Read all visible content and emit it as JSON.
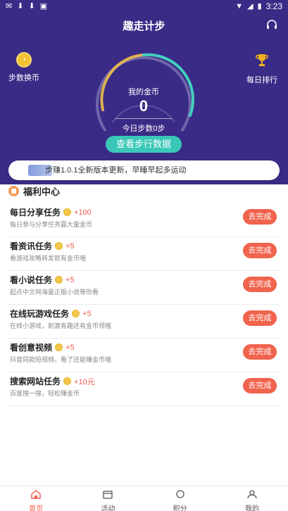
{
  "statusbar": {
    "time": "3:23"
  },
  "app": {
    "title": "趣走计步"
  },
  "side": {
    "left_label": "步数换币",
    "right_label": "每日排行"
  },
  "gauge": {
    "label": "我的金币",
    "coins": "0",
    "steps_text": "今日步数0步",
    "progress": 0.0
  },
  "actions": {
    "view_data": "查看步行数据"
  },
  "notice": {
    "text": "步赚1.0.1全新版本更新，早睡早起多运动"
  },
  "welfare": {
    "title": "福利中心",
    "tasks": [
      {
        "name": "每日分享任务",
        "reward": "+100",
        "desc": "每日参与分享任务赢大量金币",
        "button": "去完成"
      },
      {
        "name": "看资讯任务",
        "reward": "+5",
        "desc": "看游戏攻略转发就有金币哦",
        "button": "去完成"
      },
      {
        "name": "看小说任务",
        "reward": "+5",
        "desc": "起点中文网海量正版小说等你看",
        "button": "去完成"
      },
      {
        "name": "在线玩游戏任务",
        "reward": "+5",
        "desc": "在线小游戏，刺激有趣还有金币领哦",
        "button": "去完成"
      },
      {
        "name": "看创意视频",
        "reward": "+5",
        "desc": "抖音同款短视频，看了还能赚金币哦",
        "button": "去完成"
      },
      {
        "name": "搜索网站任务",
        "reward": "+10元",
        "desc": "百度搜一搜，轻松赚金币",
        "button": "去完成"
      }
    ]
  },
  "tabs": [
    {
      "label": "首页",
      "icon": "home-icon"
    },
    {
      "label": "活动",
      "icon": "calendar-icon"
    },
    {
      "label": "积分",
      "icon": "points-icon"
    },
    {
      "label": "我的",
      "icon": "user-icon"
    }
  ],
  "colors": {
    "header_bg": "#3a2b87",
    "accent_teal": "#39c7b8",
    "task_button": "#f0634d",
    "reward_red": "#f05a4e"
  }
}
